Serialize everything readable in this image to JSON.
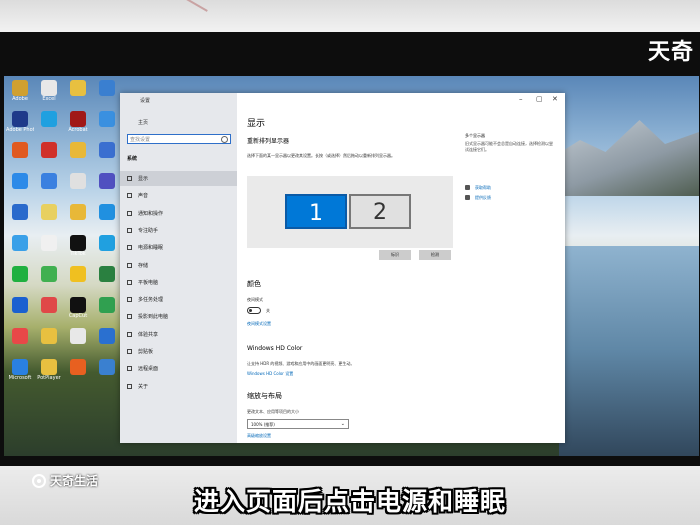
{
  "overlay": {
    "logo": "天奇",
    "brand": "天奇生活",
    "subtitle": "进入页面后点击电源和睡眠"
  },
  "desktop_icons": [
    {
      "label": "Adobe",
      "color": "#d0a030"
    },
    {
      "label": "Excel",
      "color": "#e8e8e8"
    },
    {
      "label": "",
      "color": "#e8c040"
    },
    {
      "label": "",
      "color": "#3a7fd0"
    },
    {
      "label": "Adobe Photos",
      "color": "#1e3a8a"
    },
    {
      "label": "",
      "color": "#1fa0e0"
    },
    {
      "label": "Acrobat",
      "color": "#a01818"
    },
    {
      "label": "",
      "color": "#3a90e0"
    },
    {
      "label": "",
      "color": "#e05a20"
    },
    {
      "label": "",
      "color": "#d0302a"
    },
    {
      "label": "",
      "color": "#e8b838"
    },
    {
      "label": "",
      "color": "#3a6fd0"
    },
    {
      "label": "",
      "color": "#2c8ae8"
    },
    {
      "label": "",
      "color": "#3a80e0"
    },
    {
      "label": "",
      "color": "#e0e0e0"
    },
    {
      "label": "",
      "color": "#5050c0"
    },
    {
      "label": "",
      "color": "#2a6acc"
    },
    {
      "label": "",
      "color": "#e8d060"
    },
    {
      "label": "",
      "color": "#e8b838"
    },
    {
      "label": "",
      "color": "#2090e0"
    },
    {
      "label": "",
      "color": "#3aa0e8"
    },
    {
      "label": "",
      "color": "#f0f0f0"
    },
    {
      "label": "TikTok",
      "color": "#111111"
    },
    {
      "label": "",
      "color": "#20a0e0"
    },
    {
      "label": "",
      "color": "#20b040"
    },
    {
      "label": "",
      "color": "#40b050"
    },
    {
      "label": "",
      "color": "#f0c020"
    },
    {
      "label": "",
      "color": "#2a8040"
    },
    {
      "label": "",
      "color": "#1a60d0"
    },
    {
      "label": "",
      "color": "#e04848"
    },
    {
      "label": "CapCut",
      "color": "#111111"
    },
    {
      "label": "",
      "color": "#30a050"
    },
    {
      "label": "",
      "color": "#e84848"
    },
    {
      "label": "",
      "color": "#e8c040"
    },
    {
      "label": "",
      "color": "#e8e8e8"
    },
    {
      "label": "",
      "color": "#2a70d0"
    },
    {
      "label": "Microsoft",
      "color": "#2a80e0"
    },
    {
      "label": "PotPlayer",
      "color": "#e8c040"
    },
    {
      "label": "",
      "color": "#e86020"
    },
    {
      "label": "",
      "color": "#3a80d0"
    }
  ],
  "settings": {
    "window_title": "设置",
    "home": "主页",
    "search_placeholder": "查找设置",
    "section": "系统",
    "nav": [
      "显示",
      "声音",
      "通知和操作",
      "专注助手",
      "电源和睡眠",
      "存储",
      "平板电脑",
      "多任务处理",
      "投影到此电脑",
      "体验共享",
      "剪贴板",
      "远程桌面",
      "关于"
    ],
    "main": {
      "title": "显示",
      "rearrange": "重新排列显示器",
      "rearrange_desc": "选择下面的某一显示器以更改其设置。长按（或选择）然后拖动以重新排列显示器。",
      "monitor1": "1",
      "monitor2": "2",
      "identify": "标识",
      "detect": "检测",
      "color_header": "颜色",
      "night_light": "夜间模式",
      "off": "关",
      "night_light_settings": "夜间模式设置",
      "hd_header": "Windows HD Color",
      "hd_desc": "让支持 HDR 的视频、游戏和应用中的画面更明亮、更生动。",
      "hd_link": "Windows HD Color 设置",
      "scale_header": "缩放与布局",
      "scale_label": "更改文本、应用等项目的大小",
      "scale_value": "100% (推荐)",
      "advanced_scaling": "高级缩放设置"
    },
    "right": {
      "title": "多个显示器",
      "desc": "旧式显示器可能不会总是自动连接，选择检测以尝试连接它们。",
      "help": "获取帮助",
      "feedback": "提供反馈"
    }
  }
}
